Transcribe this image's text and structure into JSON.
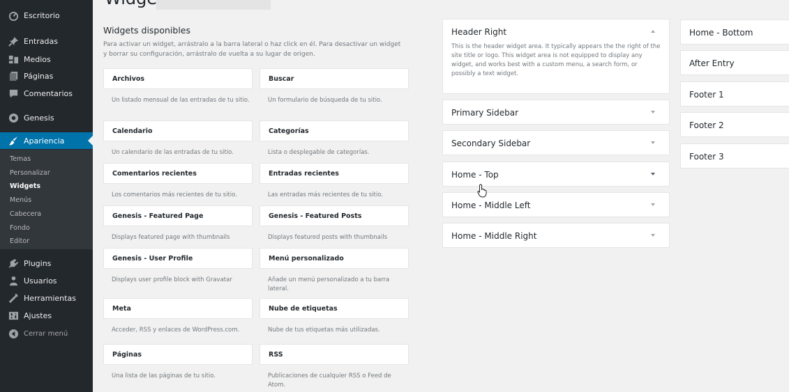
{
  "sidebar": {
    "items": [
      {
        "label": "Escritorio",
        "icon": "dashboard-icon"
      },
      {
        "label": "Entradas",
        "icon": "pushpin-icon"
      },
      {
        "label": "Medios",
        "icon": "media-icon"
      },
      {
        "label": "Páginas",
        "icon": "pages-icon"
      },
      {
        "label": "Comentarios",
        "icon": "comments-icon"
      },
      {
        "label": "Genesis",
        "icon": "genesis-icon"
      },
      {
        "label": "Apariencia",
        "icon": "appearance-icon"
      },
      {
        "label": "Plugins",
        "icon": "plugins-icon"
      },
      {
        "label": "Usuarios",
        "icon": "users-icon"
      },
      {
        "label": "Herramientas",
        "icon": "tools-icon"
      },
      {
        "label": "Ajustes",
        "icon": "settings-icon"
      },
      {
        "label": "Cerrar menú",
        "icon": "collapse-icon"
      }
    ],
    "submenu": [
      "Temas",
      "Personalizar",
      "Widgets",
      "Menús",
      "Cabecera",
      "Fondo",
      "Editor"
    ],
    "active_color": "#0073aa"
  },
  "page": {
    "title_partial": "Widgets"
  },
  "available": {
    "heading": "Widgets disponibles",
    "description": "Para activar un widget, arrástralo a la barra lateral o haz click en él. Para desactivar un widget y borrar su configuración, arrástralo de vuelta a su lugar de origen.",
    "widgets": [
      {
        "title": "Archivos",
        "desc": "Un listado mensual de las entradas de tu sitio."
      },
      {
        "title": "Buscar",
        "desc": "Un formulario de búsqueda de tu sitio."
      },
      {
        "title": "Calendario",
        "desc": "Un calendario de las entradas de tu sitio."
      },
      {
        "title": "Categorías",
        "desc": "Lista o desplegable de categorías."
      },
      {
        "title": "Comentarios recientes",
        "desc": "Los comentarios más recientes de tu sitio."
      },
      {
        "title": "Entradas recientes",
        "desc": "Las entradas más recientes de tu sitio."
      },
      {
        "title": "Genesis - Featured Page",
        "desc": "Displays featured page with thumbnails"
      },
      {
        "title": "Genesis - Featured Posts",
        "desc": "Displays featured posts with thumbnails"
      },
      {
        "title": "Genesis - User Profile",
        "desc": "Displays user profile block with Gravatar"
      },
      {
        "title": "Menú personalizado",
        "desc": "Añade un menú personalizado a tu barra lateral."
      },
      {
        "title": "Meta",
        "desc": "Acceder, RSS y enlaces de WordPress.com."
      },
      {
        "title": "Nube de etiquetas",
        "desc": "Nube de tus etiquetas más utilizadas."
      },
      {
        "title": "Páginas",
        "desc": "Una lista de las páginas de tu sitio."
      },
      {
        "title": "RSS",
        "desc": "Publicaciones de cualquier RSS o Feed de Atom."
      }
    ]
  },
  "areas_col1": [
    {
      "name": "Header Right",
      "desc": "This is the header widget area. It typically appears the the right of the site title or logo. This widget area is not equipped to display any widget, and works best with a custom menu, a search form, or possibly a text widget."
    },
    {
      "name": "Primary Sidebar"
    },
    {
      "name": "Secondary Sidebar"
    },
    {
      "name": "Home - Top"
    },
    {
      "name": "Home - Middle Left"
    },
    {
      "name": "Home - Middle Right"
    }
  ],
  "areas_col2": [
    {
      "name": "Home - Bottom"
    },
    {
      "name": "After Entry"
    },
    {
      "name": "Footer 1"
    },
    {
      "name": "Footer 2"
    },
    {
      "name": "Footer 3"
    }
  ]
}
